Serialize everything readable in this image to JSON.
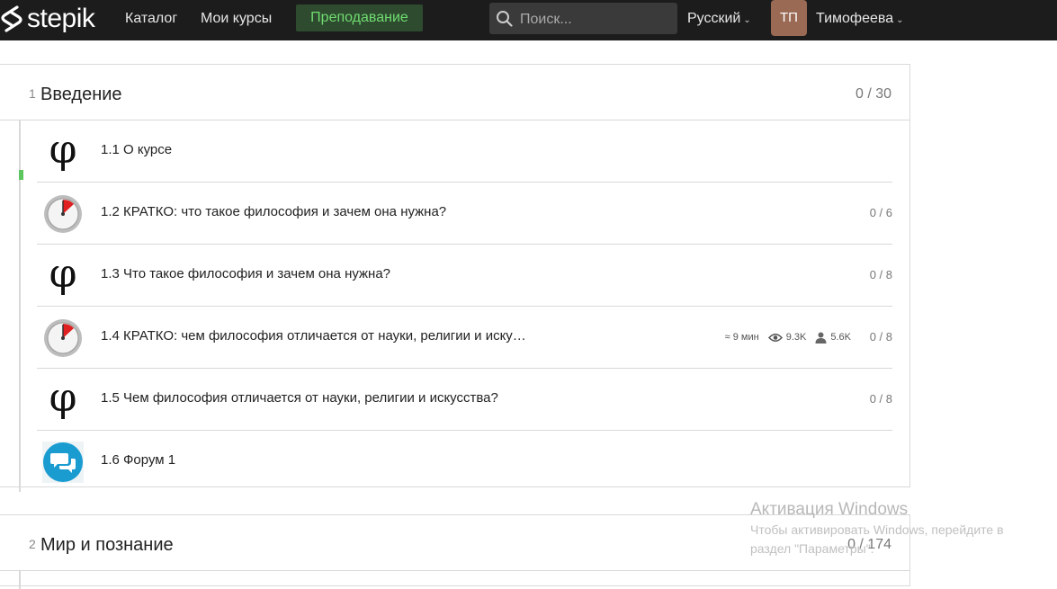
{
  "header": {
    "logo_text": "stepik",
    "nav": [
      "Каталог",
      "Мои курсы"
    ],
    "teach_label": "Преподавание",
    "search_placeholder": "Поиск...",
    "language": "Русский",
    "avatar_initials": "ТП",
    "user_name": "Тимофеева"
  },
  "sections": [
    {
      "num": "1",
      "title": "Введение",
      "score": "0 / 30",
      "lessons": [
        {
          "icon": "phi-icon",
          "title": "1.1 О курсе",
          "score": ""
        },
        {
          "icon": "timer-icon",
          "title": "1.2 КРАТКО: что такое философия и зачем она нужна?",
          "score": "0 / 6"
        },
        {
          "icon": "phi-icon",
          "title": "1.3 Что такое философия и зачем она нужна?",
          "score": "0 / 8"
        },
        {
          "icon": "timer-icon",
          "title": "1.4 КРАТКО: чем философия отличается от науки, религии и иску…",
          "score": "0 / 8",
          "time": "≈ 9 мин",
          "views": "9.3K",
          "learners": "5.6K"
        },
        {
          "icon": "phi-icon",
          "title": "1.5 Чем философия отличается от науки, религии и искусства?",
          "score": "0 / 8"
        },
        {
          "icon": "forum-icon",
          "title": "1.6 Форум 1",
          "score": ""
        }
      ]
    },
    {
      "num": "2",
      "title": "Мир и познание",
      "score": "0 / 174"
    }
  ],
  "watermark": {
    "title": "Активация Windows",
    "line1": "Чтобы активировать Windows, перейдите в",
    "line2": "раздел \"Параметры\"."
  },
  "colors": {
    "topbar": "#1c1c1c",
    "teach_bg": "#2e4b30",
    "teach_text": "#6fdc6f",
    "progress": "#5ec65e",
    "avatar": "#9a6a55"
  }
}
